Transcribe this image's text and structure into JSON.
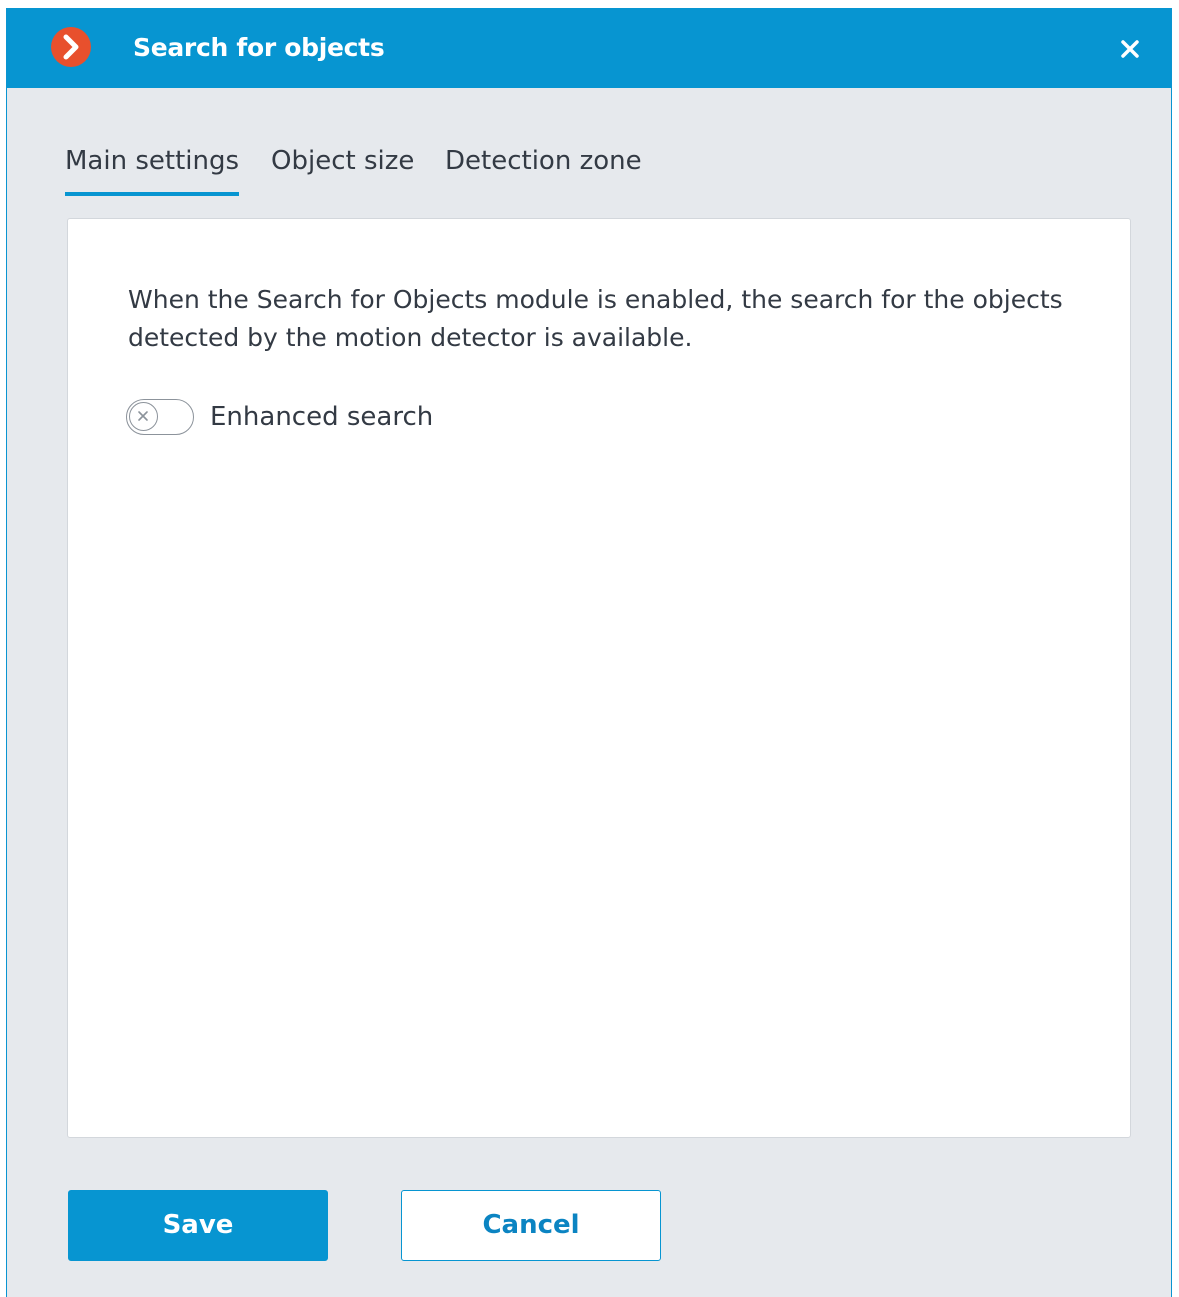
{
  "window": {
    "title": "Search for objects",
    "accent_color": "#0795d1",
    "logo_color": "#e8502d",
    "logo_icon": "chevron-right-icon",
    "close_icon": "close-icon"
  },
  "tabs": [
    {
      "label": "Main settings",
      "active": true
    },
    {
      "label": "Object size",
      "active": false
    },
    {
      "label": "Detection zone",
      "active": false
    }
  ],
  "main": {
    "description": "When the Search for Objects module is enabled, the search for the objects detected by the motion detector is available.",
    "enhanced_search": {
      "label": "Enhanced search",
      "enabled": false
    }
  },
  "footer": {
    "save_label": "Save",
    "cancel_label": "Cancel"
  }
}
